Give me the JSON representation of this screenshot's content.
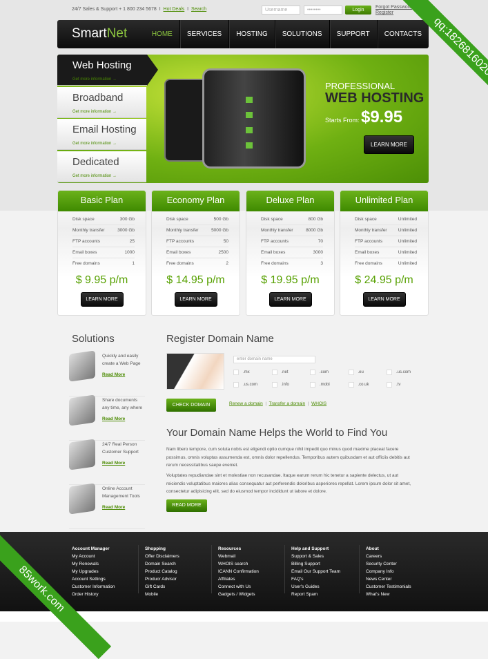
{
  "topbar": {
    "support": "24/7 Sales & Support + 1 800 234 5678",
    "sep": "I",
    "hot_deals": "Hot Deals",
    "search": "Search",
    "username_placeholder": "Username",
    "password_value": "••••••••",
    "login": "Login",
    "forgot": "Forgot Password",
    "register": "Register"
  },
  "nav": {
    "logo_a": "Smart",
    "logo_b": "Net",
    "items": [
      "HOME",
      "SERVICES",
      "HOSTING",
      "SOLUTIONS",
      "SUPPORT",
      "CONTACTS"
    ],
    "active": "HOME"
  },
  "banner": {
    "tabs": [
      {
        "title": "Web Hosting",
        "sub": "Get more information →"
      },
      {
        "title": "Broadband",
        "sub": "Get more information →"
      },
      {
        "title": "Email Hosting",
        "sub": "Get more information →"
      },
      {
        "title": "Dedicated",
        "sub": "Get more information →"
      }
    ],
    "line1": "PROFESSIONAL",
    "line2": "WEB HOSTING",
    "starts": "Starts From:",
    "price": "$9.95",
    "cta": "LEARN MORE"
  },
  "plans": [
    {
      "name": "Basic Plan",
      "rows": [
        [
          "Disk space",
          "300 Gb"
        ],
        [
          "Monthly transfer",
          "3000 Gb"
        ],
        [
          "FTP accounts",
          "25"
        ],
        [
          "Email boxes",
          "1000"
        ],
        [
          "Free domains",
          "1"
        ]
      ],
      "price": "$ 9.95 p/m",
      "cta": "LEARN MORE"
    },
    {
      "name": "Economy Plan",
      "rows": [
        [
          "Disk space",
          "500 Gb"
        ],
        [
          "Monthly transfer",
          "5000 Gb"
        ],
        [
          "FTP accounts",
          "50"
        ],
        [
          "Email boxes",
          "2500"
        ],
        [
          "Free domains",
          "2"
        ]
      ],
      "price": "$ 14.95 p/m",
      "cta": "LEARN MORE"
    },
    {
      "name": "Deluxe Plan",
      "rows": [
        [
          "Disk space",
          "800 Gb"
        ],
        [
          "Monthly transfer",
          "8000 Gb"
        ],
        [
          "FTP accounts",
          "70"
        ],
        [
          "Email boxes",
          "3000"
        ],
        [
          "Free domains",
          "3"
        ]
      ],
      "price": "$ 19.95 p/m",
      "cta": "LEARN MORE"
    },
    {
      "name": "Unlimited Plan",
      "rows": [
        [
          "Disk space",
          "Unlimited"
        ],
        [
          "Monthly transfer",
          "Unlimited"
        ],
        [
          "FTP accounts",
          "Unlimited"
        ],
        [
          "Email boxes",
          "Unlimited"
        ],
        [
          "Free domains",
          "Unlimited"
        ]
      ],
      "price": "$ 24.95 p/m",
      "cta": "LEARN MORE"
    }
  ],
  "solutions": {
    "title": "Solutions",
    "items": [
      {
        "l1": "Quickly and easily",
        "l2": "create a Web Page",
        "more": "Read More"
      },
      {
        "l1": "Share documents",
        "l2": "any time, any where",
        "more": "Read More"
      },
      {
        "l1": "24/7 Real Person",
        "l2": "Customer Support",
        "more": "Read More"
      },
      {
        "l1": "Online Account",
        "l2": "Management Tools",
        "more": "Read More"
      }
    ]
  },
  "domain": {
    "title": "Register Domain Name",
    "placeholder": "enter domain name",
    "tlds": [
      ".mx",
      ".net",
      ".com",
      ".eu",
      ".us.com",
      ".us.com",
      ".info",
      ".mobi",
      ".co.uk",
      ".tv"
    ],
    "check": "CHECK DOMAIN",
    "renew": "Renew a domain",
    "transfer": "Transfer a domain",
    "whois": "WHOIS",
    "sep": "|"
  },
  "article": {
    "title": "Your Domain Name Helps the World to Find You",
    "p1": "Nam libero tempore, cum soluta nobis est eligendi optio cumque nihil impedit quo minus quod maxime placeat facere possimus, omnis voluptas assumenda est, omnis dolor repellendus. Temporibus autem quibusdam et aut officiis debitis aut rerum necessitatibus saepe eveniet.",
    "p2": "Voluptates repudiandae sint et molestiae non recusandae. Itaque earum rerum hic tenetur a sapiente delectus, ut aut reiciendis voluptatibus maiores alias consequatur aut perferendis doloribus asperiores repellat. Lorem ipsum dolor sit amet, consectetur adipisicing elit, sed do eiusmod tempor incididunt ut labore et dolore.",
    "more": "READ MORE"
  },
  "footer": [
    {
      "title": "Account Manager",
      "links": [
        "My Account",
        "My Renewals",
        "My Upgrades",
        "Account Settings",
        "Customer Information",
        "Order History"
      ]
    },
    {
      "title": "Shopping",
      "links": [
        "Offer Disclaimers",
        "Domain Search",
        "Product Catalog",
        "Producr Advisor",
        "Gift Cards",
        "Mobile"
      ]
    },
    {
      "title": "Resources",
      "links": [
        "Webmail",
        "WHOIS search",
        "ICANN Confirmation",
        "Affiliates",
        "Connect with Us",
        "Gadgets / Widgets"
      ]
    },
    {
      "title": "Help and Support",
      "links": [
        "Support & Sales",
        "Billing Support",
        "Email Our Support Team",
        "FAQ's",
        "User's Guides",
        "Report Spam"
      ]
    },
    {
      "title": "About",
      "links": [
        "Careers",
        "Security Center",
        "Company Info",
        "News Center",
        "Customer Testimonials",
        "What's New"
      ]
    }
  ],
  "watermarks": {
    "top": "qq:1826816020",
    "bottom": "85work.com"
  },
  "colors": {
    "accent": "#6bb21b",
    "dark": "#1a1a1a"
  }
}
